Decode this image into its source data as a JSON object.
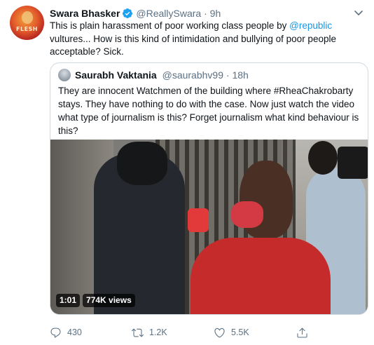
{
  "tweet": {
    "author": {
      "name": "Swara Bhasker",
      "handle": "@ReallySwara",
      "separator": "·",
      "time": "9h",
      "avatar_text": "FLESH"
    },
    "text_before_mention": "This is plain harassment of poor working class people by ",
    "mention": "@republic",
    "text_after_mention": " vultures... How is this kind of intimidation and bullying of poor people acceptable? Sick."
  },
  "quoted_tweet": {
    "author": {
      "name": "Saurabh Vaktania",
      "handle": "@saurabhv99",
      "separator": "·",
      "time": "18h"
    },
    "text": "They are innocent Watchmen of the building where #RheaChakrobarty stays. They have nothing to do with the case. Now just watch the video what type of journalism is this? Forget journalism what kind behaviour is this?",
    "video": {
      "duration": "1:01",
      "views": "774K views"
    }
  },
  "actions": {
    "reply_count": "430",
    "retweet_count": "1.2K",
    "like_count": "5.5K"
  },
  "colors": {
    "link": "#1b95e0",
    "secondary_text": "#5b7083",
    "border": "#cfd9de",
    "verified": "#1da1f2"
  },
  "icons": [
    "verified-badge-icon",
    "chevron-down-icon",
    "reply-icon",
    "retweet-icon",
    "like-icon",
    "share-icon"
  ]
}
